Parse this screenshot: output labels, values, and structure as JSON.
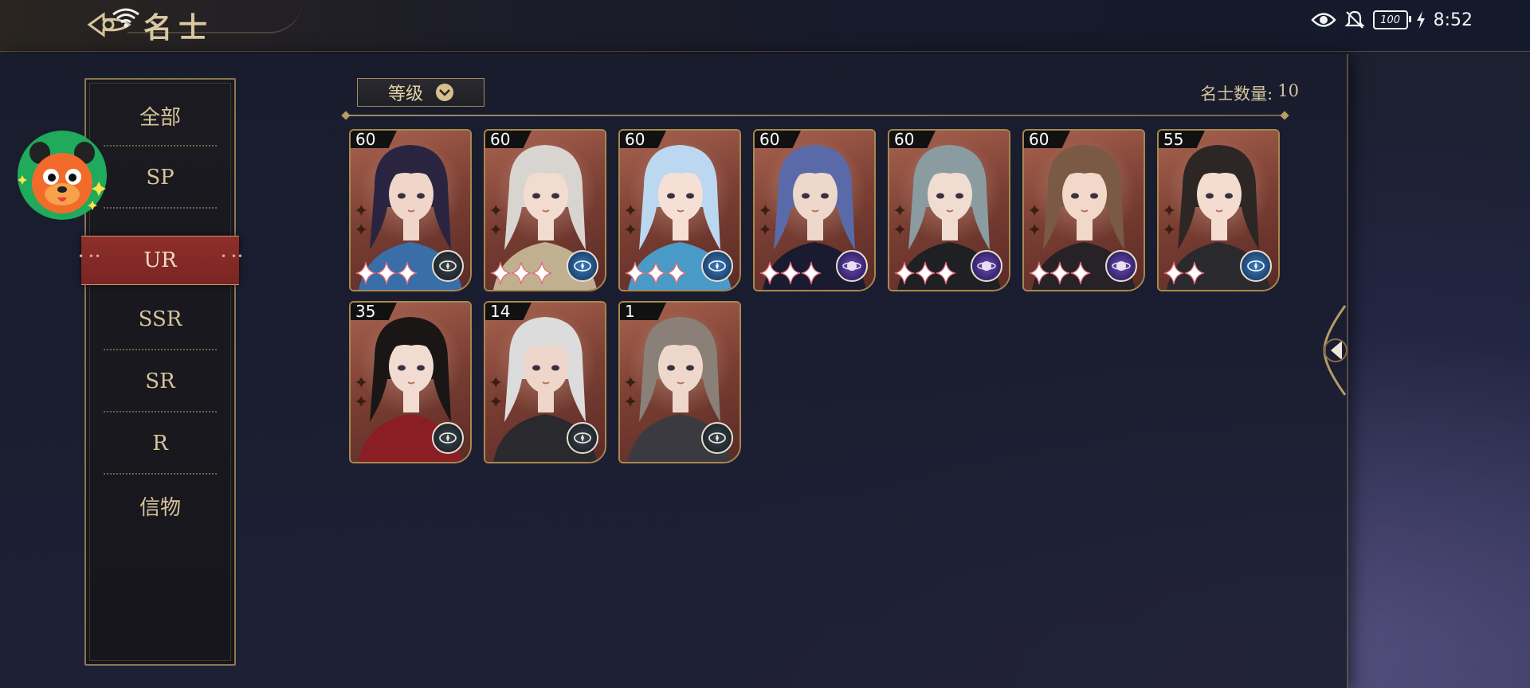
{
  "header": {
    "title": "名士"
  },
  "status_bar": {
    "battery": "100",
    "time": "8:52"
  },
  "categories": [
    {
      "label": "全部",
      "active": false
    },
    {
      "label": "SP",
      "active": false
    },
    {
      "label": "UR",
      "active": true
    },
    {
      "label": "SSR",
      "active": false
    },
    {
      "label": "SR",
      "active": false
    },
    {
      "label": "R",
      "active": false
    },
    {
      "label": "信物",
      "active": false
    }
  ],
  "sort": {
    "label": "等级"
  },
  "count": {
    "label": "名士数量:",
    "value": "10"
  },
  "cards": [
    {
      "level": "60",
      "stars": 3,
      "faction": "neutral",
      "hair": "#2a2440",
      "skin": "#f0d6c8",
      "accent": "#3a6ea8"
    },
    {
      "level": "60",
      "stars": 3,
      "faction": "blue",
      "hair": "#d8d4d0",
      "skin": "#f2dccf",
      "accent": "#c0b090"
    },
    {
      "level": "60",
      "stars": 3,
      "faction": "blue",
      "hair": "#bcd8f0",
      "skin": "#f6e0d6",
      "accent": "#4a9ac8"
    },
    {
      "level": "60",
      "stars": 3,
      "faction": "purple",
      "hair": "#5a6aa8",
      "skin": "#eed8cc",
      "accent": "#1a1a30"
    },
    {
      "level": "60",
      "stars": 3,
      "faction": "purple",
      "hair": "#8a9ca0",
      "skin": "#f0dcd0",
      "accent": "#1f2024"
    },
    {
      "level": "60",
      "stars": 3,
      "faction": "purple",
      "hair": "#7a5a44",
      "skin": "#f2d8c8",
      "accent": "#262226"
    },
    {
      "level": "55",
      "stars": 2,
      "faction": "blue",
      "hair": "#2c2624",
      "skin": "#f4dccf",
      "accent": "#2a2a2e"
    },
    {
      "level": "35",
      "stars": 0,
      "faction": "neutral",
      "hair": "#1a1616",
      "skin": "#f2dcd2",
      "accent": "#8a1e24"
    },
    {
      "level": "14",
      "stars": 0,
      "faction": "neutral",
      "hair": "#dcdcdc",
      "skin": "#efd6ca",
      "accent": "#2a2a2e"
    },
    {
      "level": "1",
      "stars": 0,
      "faction": "neutral",
      "hair": "#8a8078",
      "skin": "#eed8cc",
      "accent": "#3a3a40"
    }
  ],
  "colors": {
    "gold": "#d8c49a",
    "active_tab": "#8e2f2b",
    "card_frame": "#a8874f"
  }
}
